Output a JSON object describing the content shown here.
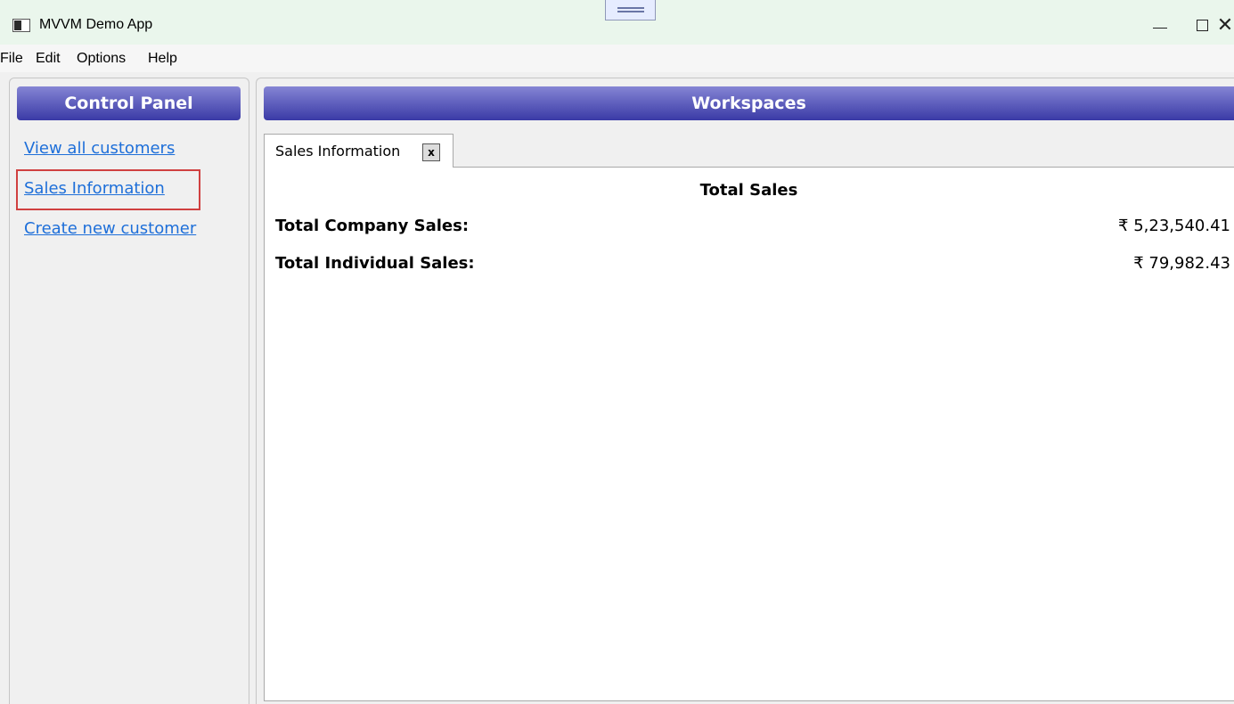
{
  "window": {
    "title": "MVVM Demo App",
    "controls": {
      "minimize": "—",
      "maximize": "☐",
      "close": "✕"
    }
  },
  "menu": [
    "File",
    "Edit",
    "Options",
    "Help"
  ],
  "control_panel": {
    "title": "Control Panel",
    "links": [
      "View all customers",
      "Sales Information",
      "Create new customer"
    ]
  },
  "workspaces": {
    "title": "Workspaces",
    "tabs": [
      {
        "label": "Sales Information",
        "close": "x"
      }
    ],
    "sales": {
      "title": "Total Sales",
      "rows": [
        {
          "label": "Total Company Sales:",
          "value": "₹ 5,23,540.41"
        },
        {
          "label": "Total Individual Sales:",
          "value": "₹ 79,982.43"
        }
      ]
    }
  }
}
